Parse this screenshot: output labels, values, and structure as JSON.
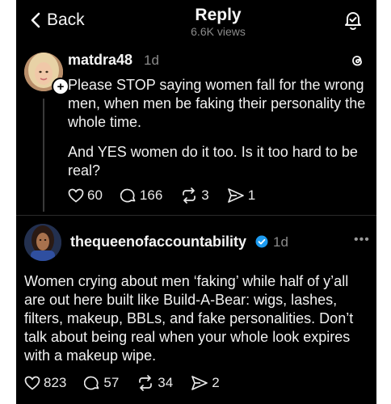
{
  "header": {
    "back_label": "Back",
    "title": "Reply",
    "views": "6.6K views"
  },
  "post": {
    "username": "matdra48",
    "time": "1d",
    "paragraphs": [
      "Please STOP saying women fall for the wrong men, when men be faking their personality the whole time.",
      "And YES women do it too. Is it too hard to be real?"
    ],
    "likes": "60",
    "comments": "166",
    "reposts": "3",
    "shares": "1"
  },
  "reply": {
    "username": "thequeenofaccountability",
    "time": "1d",
    "more_label": "•••",
    "text": "Women crying about men ‘faking’ while half of y’all are out here built like Build-A-Bear: wigs, lashes, filters, makeup, BBLs, and fake personalities. Don’t talk about being real when your whole look expires with a makeup wipe.",
    "likes": "823",
    "comments": "57",
    "reposts": "34",
    "shares": "2"
  },
  "colors": {
    "background": "#000000",
    "verified_badge": "#1d9bf0",
    "muted_text": "#8a8a8a"
  },
  "icons": [
    "chevron-left-icon",
    "bell-check-icon",
    "threads-icon",
    "plus-icon",
    "heart-icon",
    "comment-icon",
    "repost-icon",
    "share-icon",
    "verified-icon",
    "more-icon"
  ]
}
